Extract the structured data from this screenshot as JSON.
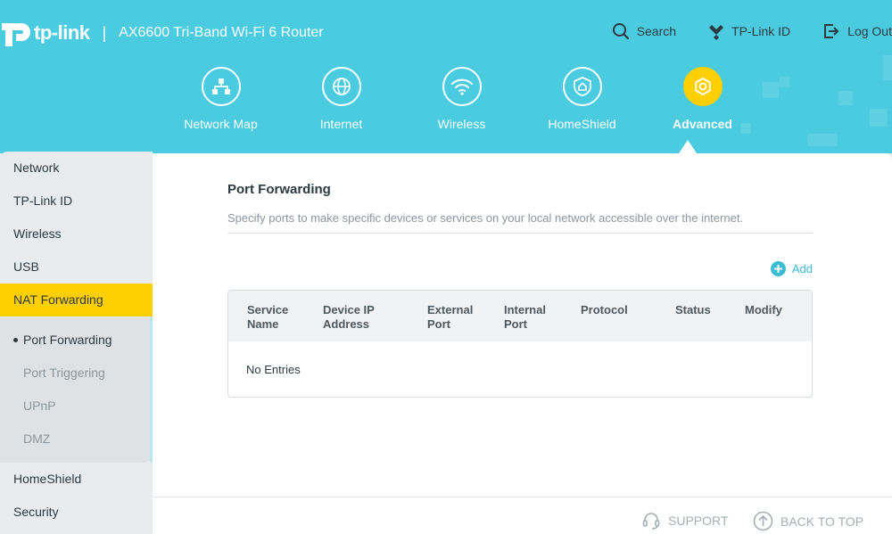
{
  "header": {
    "brand": "tp-link",
    "model": "AX6600 Tri-Band Wi-Fi 6 Router",
    "actions": [
      {
        "label": "Search",
        "icon": "search-icon"
      },
      {
        "label": "TP-Link ID",
        "icon": "tplink-id-icon"
      },
      {
        "label": "Log Out",
        "icon": "logout-icon"
      }
    ]
  },
  "nav": {
    "items": [
      {
        "label": "Network Map",
        "icon": "network-map-icon",
        "active": false
      },
      {
        "label": "Internet",
        "icon": "globe-icon",
        "active": false
      },
      {
        "label": "Wireless",
        "icon": "wifi-icon",
        "active": false
      },
      {
        "label": "HomeShield",
        "icon": "homeshield-icon",
        "active": false
      },
      {
        "label": "Advanced",
        "icon": "gear-icon",
        "active": true
      }
    ]
  },
  "sidebar": {
    "items": [
      {
        "label": "Network"
      },
      {
        "label": "TP-Link ID"
      },
      {
        "label": "Wireless"
      },
      {
        "label": "USB"
      },
      {
        "label": "NAT Forwarding"
      },
      {
        "label": "HomeShield"
      },
      {
        "label": "Security"
      }
    ],
    "submenu": [
      {
        "label": "Port Forwarding"
      },
      {
        "label": "Port Triggering"
      },
      {
        "label": "UPnP"
      },
      {
        "label": "DMZ"
      }
    ]
  },
  "main": {
    "title": "Port Forwarding",
    "description": "Specify ports to make specific devices or services on your local network accessible over the internet.",
    "add_label": "Add",
    "table": {
      "columns": [
        {
          "line1": "Service",
          "line2": "Name"
        },
        {
          "line1": "Device IP",
          "line2": "Address"
        },
        {
          "line1": "External",
          "line2": "Port"
        },
        {
          "line1": "Internal",
          "line2": "Port"
        },
        {
          "line1": "Protocol",
          "line2": ""
        },
        {
          "line1": "Status",
          "line2": ""
        },
        {
          "line1": "Modify",
          "line2": ""
        }
      ],
      "empty_text": "No Entries"
    }
  },
  "footer": {
    "support": "SUPPORT",
    "back_to_top": "BACK TO TOP"
  },
  "colors": {
    "header_bg": "#4acbdf",
    "accent": "#ffcf00",
    "link": "#3cbcd2"
  }
}
